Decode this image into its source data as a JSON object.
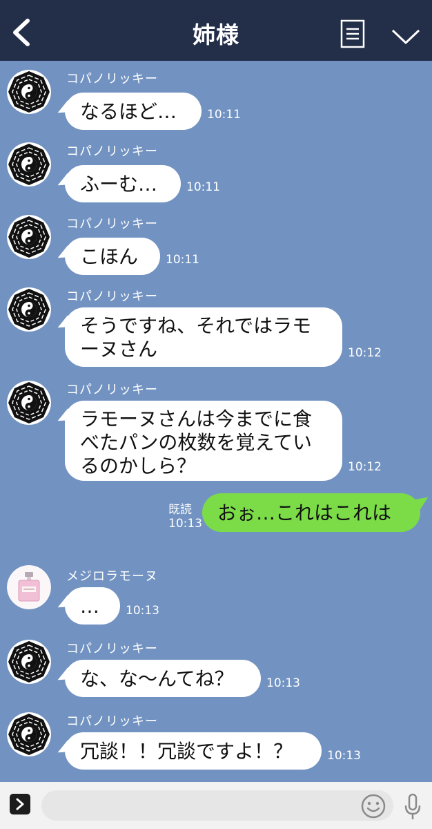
{
  "header": {
    "title": "姉様"
  },
  "contacts": {
    "kopano": "コパノリッキー",
    "mejiro": "メジロラモーヌ"
  },
  "messages": [
    {
      "sender": "コパノリッキー",
      "text": "なるほど…",
      "time": "10:11"
    },
    {
      "sender": "コパノリッキー",
      "text": "ふーむ…",
      "time": "10:11"
    },
    {
      "sender": "コパノリッキー",
      "text": "こほん",
      "time": "10:11"
    },
    {
      "sender": "コパノリッキー",
      "text": "そうですね、それではラモ\nーヌさん",
      "time": "10:12"
    },
    {
      "sender": "コパノリッキー",
      "text": "ラモーヌさんは今までに食\nべたパンの枚数を覚えてい\nるのかしら？",
      "time": "10:12"
    },
    {
      "sender": "me",
      "text": "おぉ…これはこれは",
      "read": "既読",
      "time": "10:13"
    },
    {
      "sender": "メジロラモーヌ",
      "text": "…",
      "time": "10:13"
    },
    {
      "sender": "コパノリッキー",
      "text": "な、な〜んてね？",
      "time": "10:13"
    },
    {
      "sender": "コパノリッキー",
      "text": "冗談！！冗談ですよ！？",
      "time": "10:13"
    }
  ],
  "footer": {
    "input_value": "",
    "placeholder": ""
  },
  "colors": {
    "background": "#7293c2",
    "header": "#232e49",
    "outgoing_bubble": "#7bdc48",
    "incoming_bubble": "#ffffff"
  },
  "icons": [
    "back-icon",
    "menu-icon",
    "chevron-down-icon",
    "expand-icon",
    "emoji-icon",
    "microphone-icon"
  ]
}
